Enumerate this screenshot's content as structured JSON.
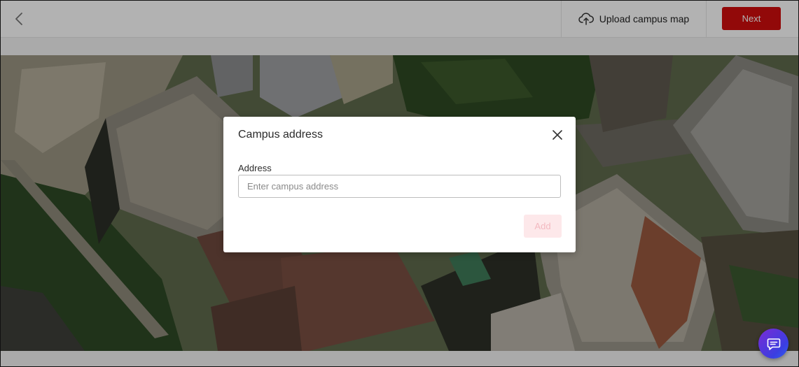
{
  "header": {
    "back_icon": "chevron-left-icon",
    "upload": {
      "icon": "cloud-upload-icon",
      "label": "Upload campus map"
    },
    "next_label": "Next",
    "next_color": "#d10e0e"
  },
  "map": {
    "type": "satellite-imagery"
  },
  "modal": {
    "title": "Campus address",
    "close_icon": "close-icon",
    "field_label": "Address",
    "input_value": "",
    "input_placeholder": "Enter campus address",
    "add_label": "Add",
    "add_state": "disabled"
  },
  "chat": {
    "icon": "chat-icon",
    "accent": "#5a35e0"
  }
}
